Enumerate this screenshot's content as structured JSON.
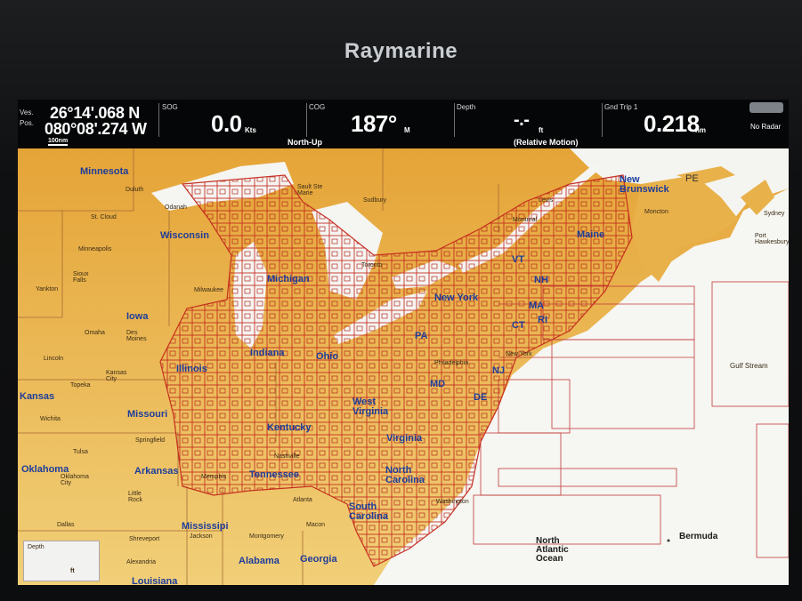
{
  "device": {
    "brand": "Raymarine"
  },
  "databar": {
    "position": {
      "label_top": "Ves.",
      "label_bottom": "Pos.",
      "lat": "26°14'.068 N",
      "lon": "080°08'.274 W",
      "scale": "100nm"
    },
    "sog": {
      "label": "SOG",
      "value": "0.0",
      "unit": "Kts"
    },
    "cog": {
      "label": "COG",
      "value": "187°",
      "unit": "M",
      "mode": "North-Up"
    },
    "depth": {
      "label": "Depth",
      "value": "-.-",
      "unit": "ft",
      "motion": "(Relative Motion)"
    },
    "trip": {
      "label": "Gnd Trip 1",
      "value": "0.218",
      "unit": "nm"
    },
    "radar": {
      "status": "No Radar"
    }
  },
  "map": {
    "states": [
      {
        "name": "Minnesota"
      },
      {
        "name": "Wisconsin"
      },
      {
        "name": "Michigan"
      },
      {
        "name": "Iowa"
      },
      {
        "name": "Illinois"
      },
      {
        "name": "Indiana"
      },
      {
        "name": "Ohio"
      },
      {
        "name": "Missouri"
      },
      {
        "name": "Kentucky"
      },
      {
        "name": "West Virginia"
      },
      {
        "name": "Virginia"
      },
      {
        "name": "Arkansas"
      },
      {
        "name": "Tennessee"
      },
      {
        "name": "North Carolina"
      },
      {
        "name": "South Carolina"
      },
      {
        "name": "Mississipi"
      },
      {
        "name": "Alabama"
      },
      {
        "name": "Georgia"
      },
      {
        "name": "New York"
      },
      {
        "name": "PA"
      },
      {
        "name": "MD"
      },
      {
        "name": "NJ"
      },
      {
        "name": "DE"
      },
      {
        "name": "VT"
      },
      {
        "name": "NH"
      },
      {
        "name": "MA"
      },
      {
        "name": "RI"
      },
      {
        "name": "CT"
      },
      {
        "name": "Maine"
      },
      {
        "name": "New Brunswick"
      },
      {
        "name": "PE"
      },
      {
        "name": "Oklahoma"
      },
      {
        "name": "Kansas"
      },
      {
        "name": "Louisiana"
      }
    ],
    "cities": [
      "Duluth",
      "Sault Ste Marie",
      "Sudbury",
      "St. Cloud",
      "Minneapolis",
      "Sioux Falls",
      "Yankton",
      "Milwaukee",
      "Toronto",
      "Omaha",
      "Des Moines",
      "Lincoln",
      "Topeka",
      "Kansas City",
      "Wichita",
      "Springfield",
      "Tulsa",
      "Oklahoma City",
      "Little Rock",
      "Memphis",
      "Nashville",
      "Atlanta",
      "Macon",
      "Montgomery",
      "Jackson",
      "Shreveport",
      "Alexandria",
      "Dallas",
      "Montreal",
      "Levis",
      "Moncton",
      "Sydney",
      "Port Hawkesbury",
      "New York",
      "Philadelphia",
      "Washington",
      "Odanah"
    ],
    "ocean_labels": [
      "North Atlantic Ocean",
      "Bermuda",
      "Gulf Stream"
    ],
    "depth_box": {
      "label": "Depth",
      "unit": "ft"
    }
  }
}
